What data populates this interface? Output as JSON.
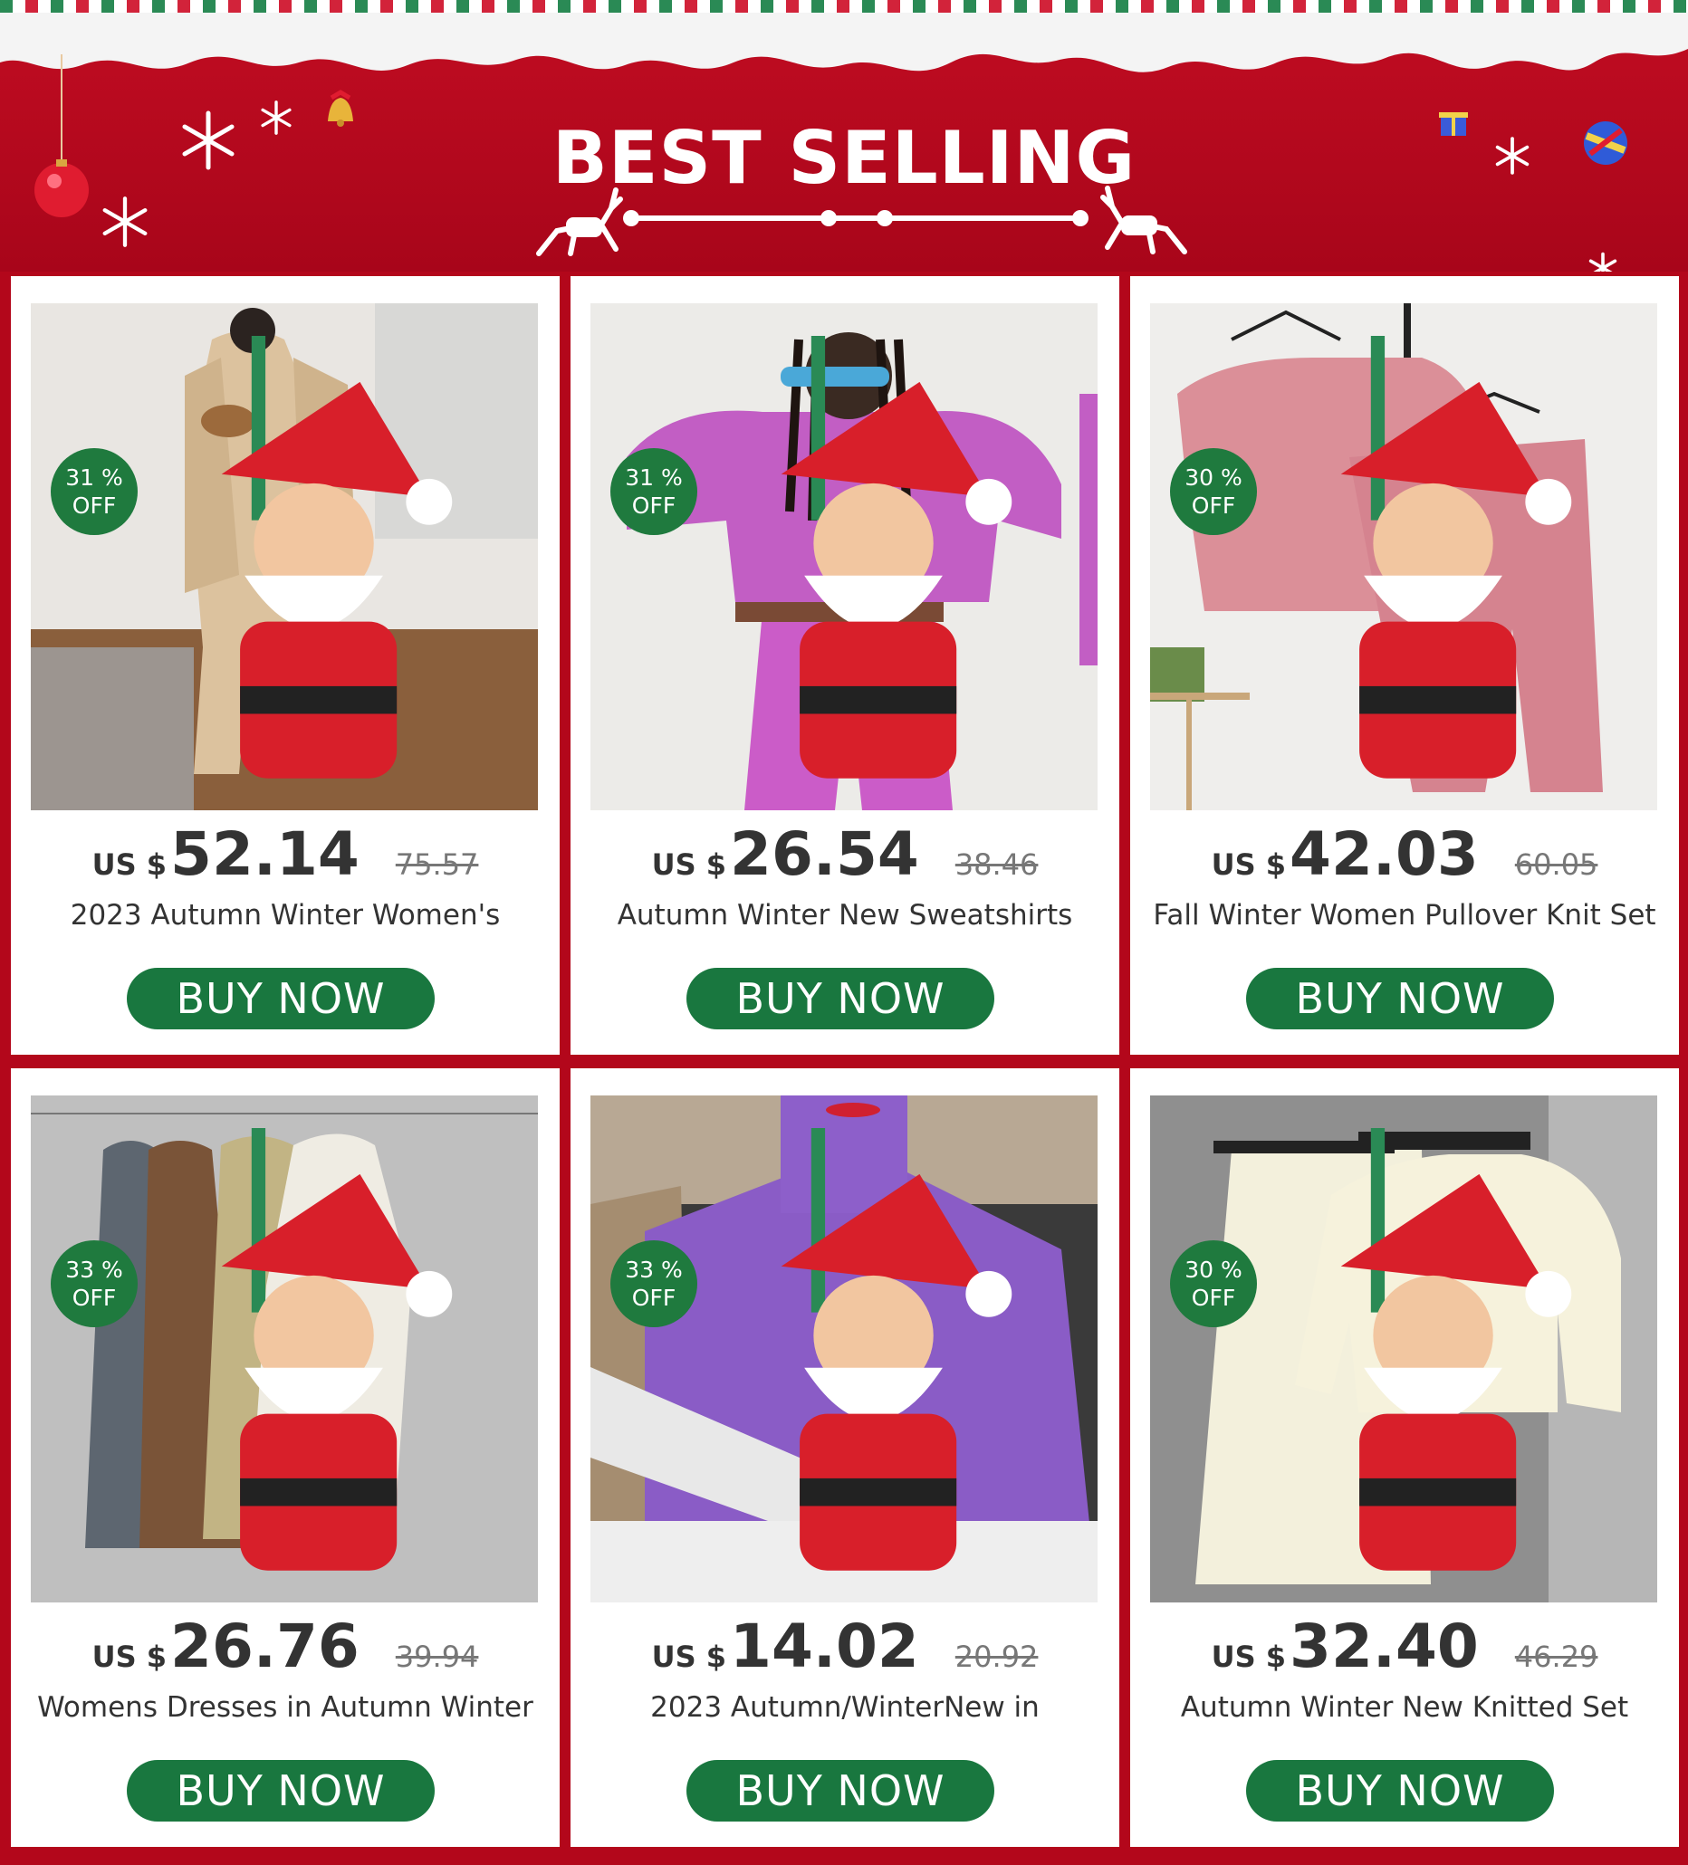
{
  "banner": {
    "title": "BEST SELLING"
  },
  "colors": {
    "background": "#b3071b",
    "button": "#19773f",
    "badge": "#1f7a3e"
  },
  "products": [
    {
      "discount": "31 %",
      "off": "OFF",
      "currency": "US $",
      "price": "52.14",
      "original": "75.57",
      "title": "2023  Autumn Winter Women's",
      "button": "BUY NOW"
    },
    {
      "discount": "31 %",
      "off": "OFF",
      "currency": "US $",
      "price": "26.54",
      "original": "38.46",
      "title": "Autumn Winter New  Sweatshirts",
      "button": "BUY NOW"
    },
    {
      "discount": "30 %",
      "off": "OFF",
      "currency": "US $",
      "price": "42.03",
      "original": "60.05",
      "title": "Fall  Winter Women Pullover Knit Set",
      "button": "BUY NOW"
    },
    {
      "discount": "33 %",
      "off": "OFF",
      "currency": "US $",
      "price": "26.76",
      "original": "39.94",
      "title": "Womens Dresses  in  Autumn Winter",
      "button": "BUY NOW"
    },
    {
      "discount": "33 %",
      "off": "OFF",
      "currency": "US $",
      "price": "14.02",
      "original": "20.92",
      "title": "2023   Autumn/WinterNew in",
      "button": "BUY NOW"
    },
    {
      "discount": "30 %",
      "off": "OFF",
      "currency": "US $",
      "price": "32.40",
      "original": "46.29",
      "title": "Autumn Winter New  Knitted Set",
      "button": "BUY NOW"
    }
  ]
}
